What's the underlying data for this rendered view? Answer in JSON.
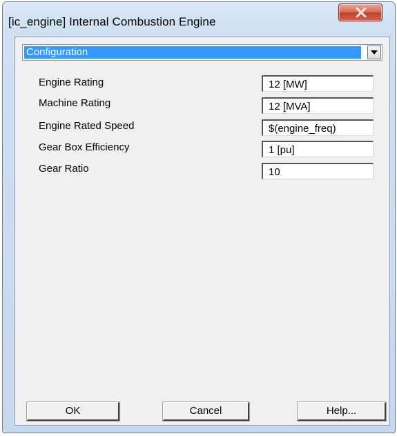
{
  "window": {
    "title": "[ic_engine] Internal Combustion Engine",
    "close_icon": "close-x-icon"
  },
  "section_select": {
    "value": "Configuration",
    "arrow_icon": "dropdown-arrow-icon"
  },
  "properties": [
    {
      "label": "Engine Rating",
      "value": "12 [MW]"
    },
    {
      "label": "Machine Rating",
      "value": "12 [MVA]"
    },
    {
      "label": "Engine Rated Speed",
      "value": "$(engine_freq)"
    },
    {
      "label": "Gear Box Efficiency",
      "value": "1 [pu]"
    },
    {
      "label": "Gear Ratio",
      "value": "10"
    }
  ],
  "buttons": {
    "ok": "OK",
    "cancel": "Cancel",
    "help": "Help..."
  },
  "colors": {
    "selection": "#3399ff",
    "close_button": "#c2402a",
    "window_frame": "#cfe0f2",
    "client_background": "#f0f0f0"
  }
}
